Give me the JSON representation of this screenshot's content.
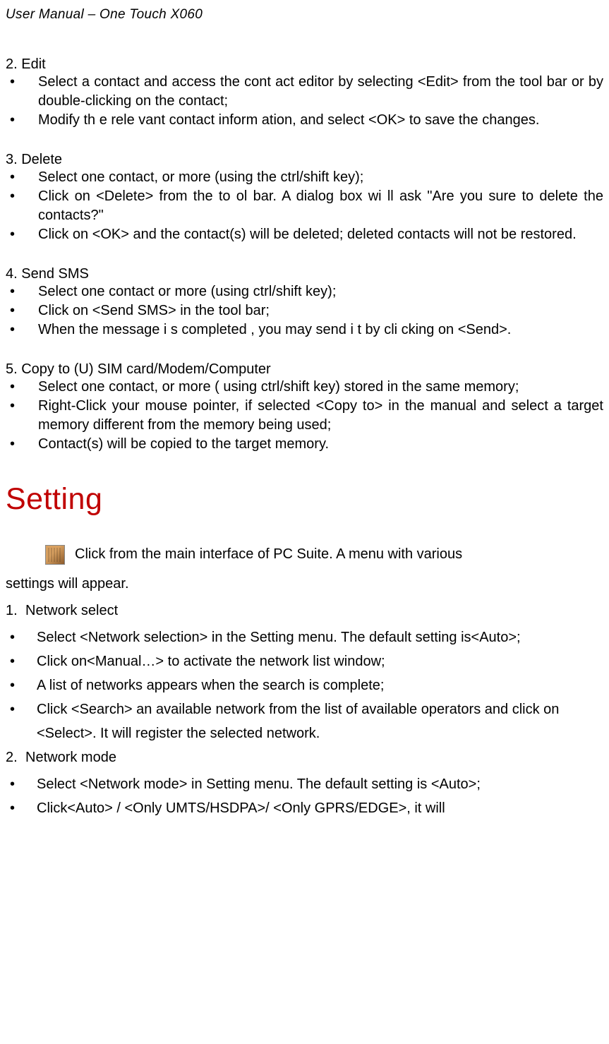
{
  "header": "User Manual – One Touch X060",
  "s2": {
    "title": "2. Edit",
    "items": [
      "Select a contact and access the cont act editor by selecting <Edit> from the tool bar or by double-clicking on the contact;",
      "Modify th e rele vant contact inform ation, and select <OK> to save the changes."
    ]
  },
  "s3": {
    "title": "3. Delete",
    "items": [
      "Select one contact, or more (using the ctrl/shift key);",
      "Click on <Delete> from the to ol bar. A  dialog box wi ll ask \"Are you sure to delete the contacts?\"",
      "Click on <OK> and the contact(s) will be deleted; deleted contacts will not be restored."
    ]
  },
  "s4": {
    "title": "4. Send SMS",
    "items": [
      "Select one contact or more (using ctrl/shift key);",
      "Click on <Send SMS> in the tool bar;",
      "When the  message i s completed , you may send i  t by cli cking on <Send>."
    ]
  },
  "s5": {
    "title": "5. Copy to (U) SIM card/Modem/Computer",
    "items": [
      "Select one contact, or more ( using ctrl/shift key) stored in the same memory;",
      "Right-Click your mouse pointer, if selected <Copy to> in the manual and select a target memory different from the memory being used;",
      "Contact(s) will be copied to the target memory."
    ]
  },
  "heading": "Setting",
  "iconText": "Click from the main interface of PC Suite. A menu with various",
  "iconTextLine2": "settings will appear.",
  "n1": {
    "num": "1.",
    "title": "Network select",
    "items": [
      "Select <Network selection> in the Setting menu. The default setting is<Auto>;",
      "Click on<Manual…> to activate the network list window;",
      "A list of networks appears when the search is complete;",
      "Click <Search> an available network from the list of available operators and click on <Select>. It will register the selected network."
    ]
  },
  "n2": {
    "num": "2.",
    "title": "Network mode",
    "items": [
      "Select <Network mode> in Setting menu. The default setting is <Auto>;",
      "Click<Auto> / <Only UMTS/HSDPA>/ <Only GPRS/EDGE>, it will"
    ]
  }
}
